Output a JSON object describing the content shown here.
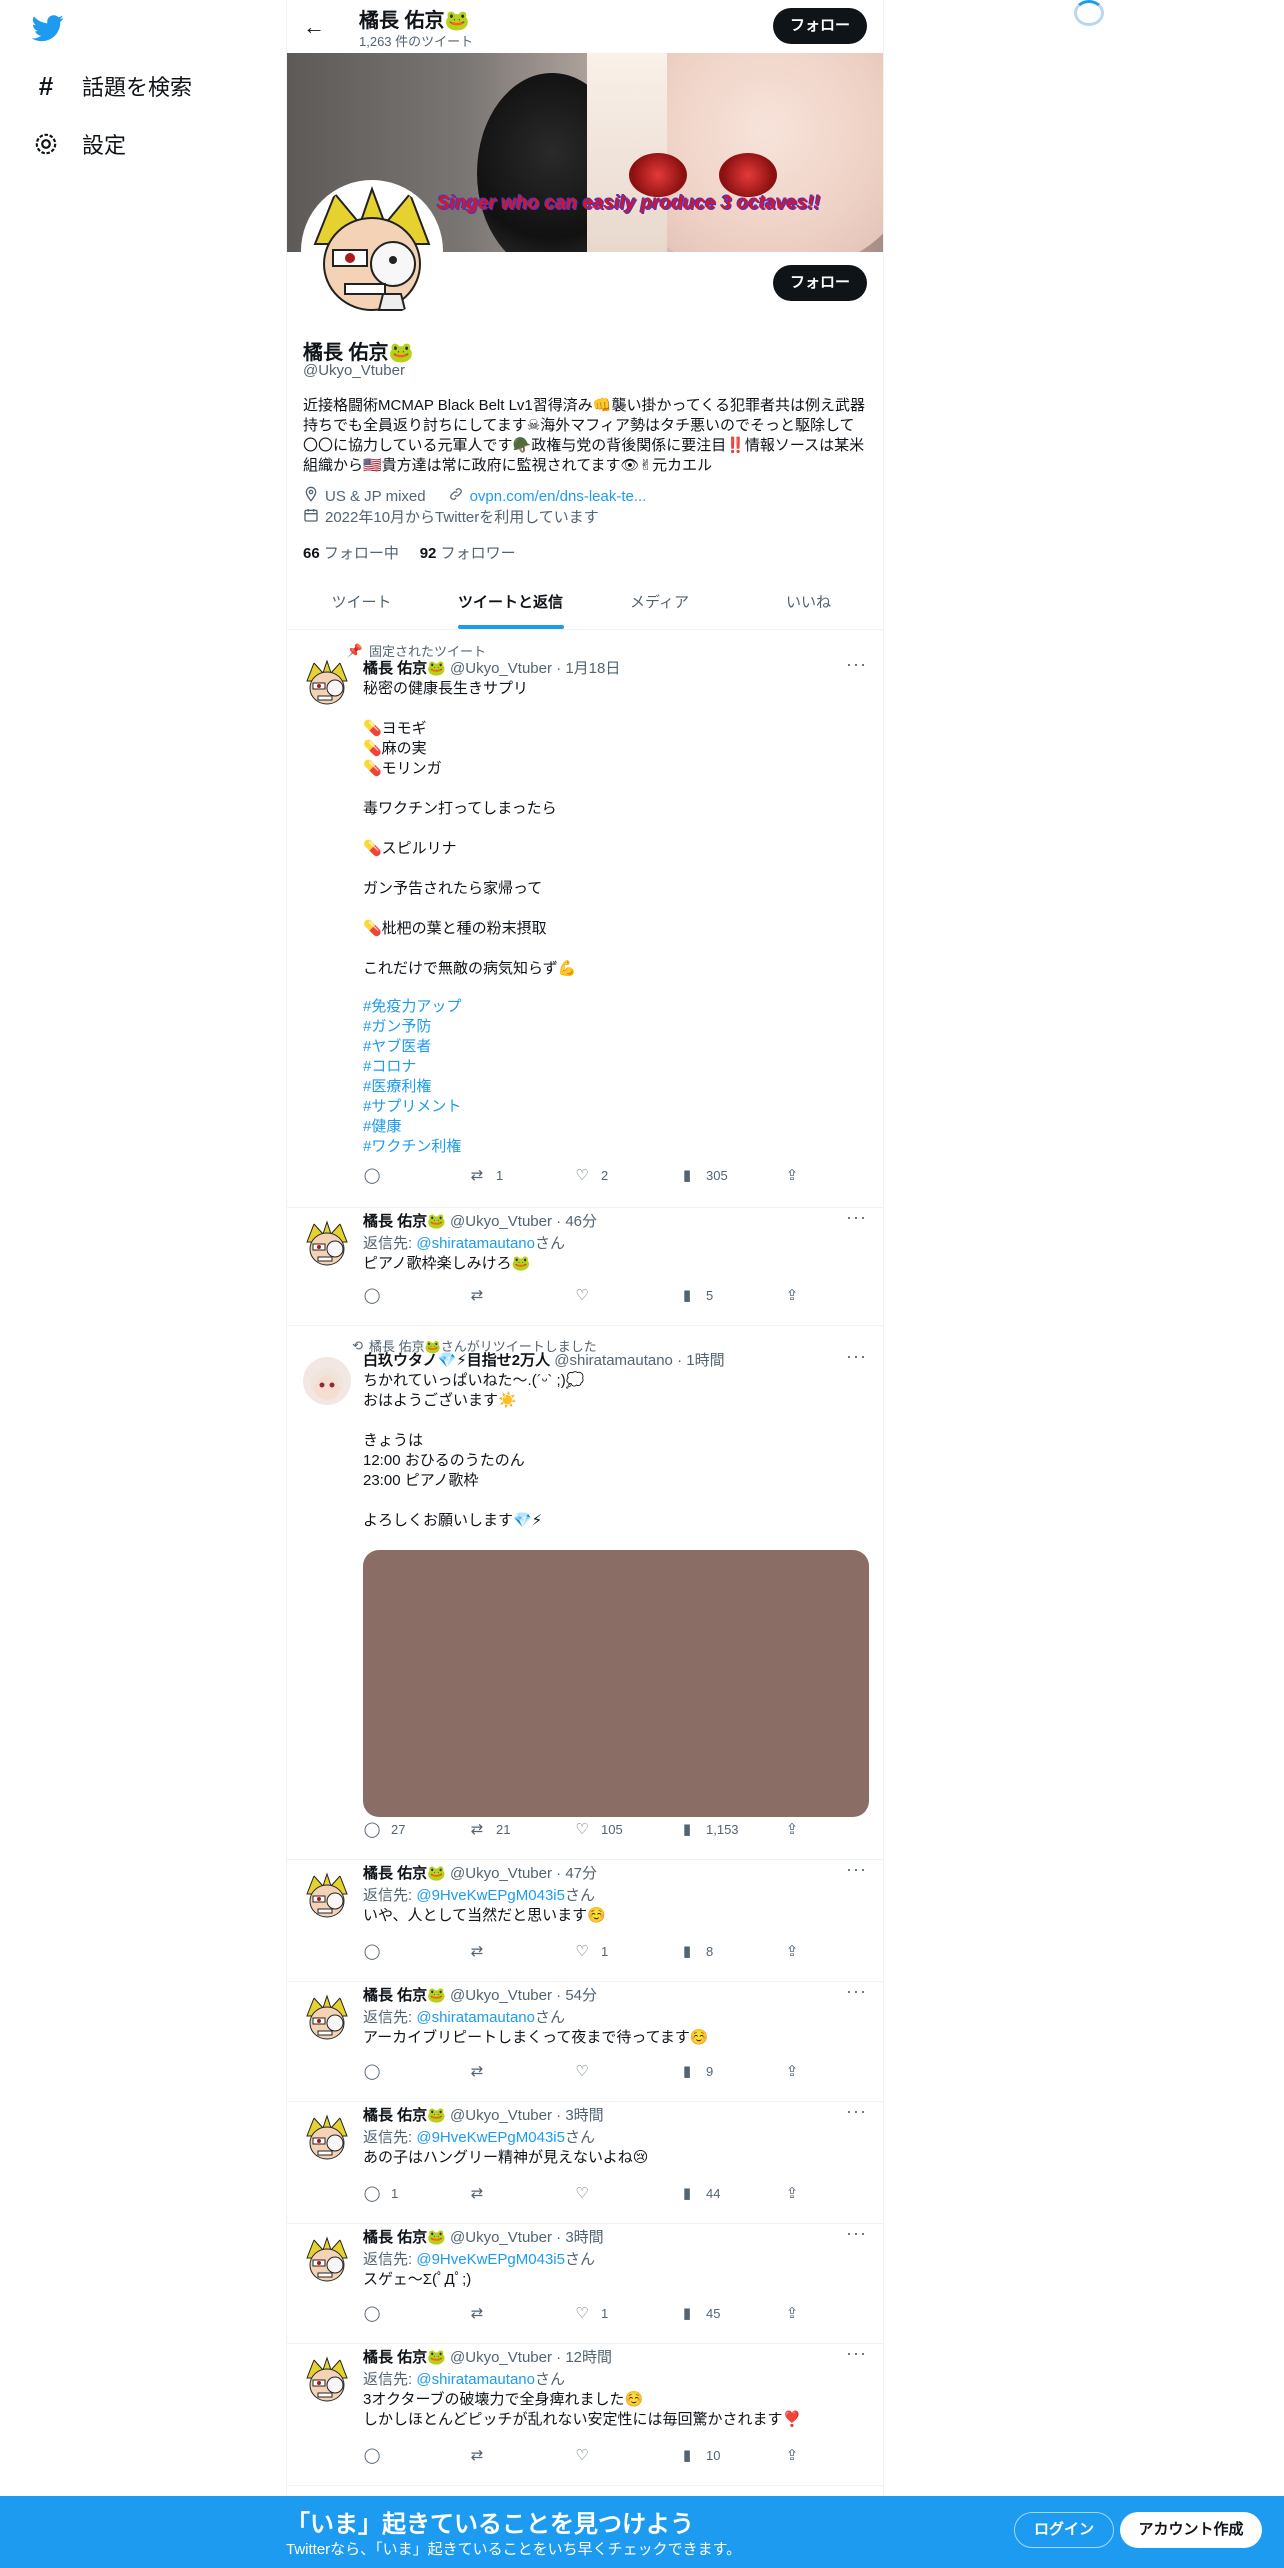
{
  "nav": {
    "explore": "話題を検索",
    "settings": "設定"
  },
  "header": {
    "name": "橘長 佑京🐸",
    "tweet_count": "1,263 件のツイート",
    "follow": "フォロー"
  },
  "banner": {
    "text": "Singer who can easily produce 3 octaves!!"
  },
  "profile": {
    "name": "橘長 佑京🐸",
    "handle": "@Ukyo_Vtuber",
    "bio": "近接格闘術MCMAP Black Belt Lv1習得済み👊襲い掛かってくる犯罪者共は例え武器持ちでも全員返り討ちにしてます☠海外マフィア勢はタチ悪いのでそっと駆除して〇〇に協力している元軍人です🪖政権与党の背後関係に要注目‼️情報ソースは某米組織から🇺🇸貴方達は常に政府に監視されてます👁✌元カエル",
    "location": "US & JP mixed",
    "url": "ovpn.com/en/dns-leak-te...",
    "joined": "2022年10月からTwitterを利用しています",
    "following_count": "66",
    "following_label": "フォロー中",
    "followers_count": "92",
    "followers_label": "フォロワー",
    "follow": "フォロー"
  },
  "tabs": [
    "ツイート",
    "ツイートと返信",
    "メディア",
    "いいね"
  ],
  "tweets": [
    {
      "social": "固定されたツイート",
      "name": "橘長 佑京🐸",
      "handle": "@Ukyo_Vtuber",
      "time": "1月18日",
      "body": "秘密の健康長生きサプリ\n\n💊ヨモギ\n💊麻の実\n💊モリンガ\n\n毒ワクチン打ってしまったら\n\n💊スピルリナ\n\nガン予告されたら家帰って\n\n💊枇杷の葉と種の粉末摂取\n\nこれだけで無敵の病気知らず💪",
      "tags": [
        "#免疫力アップ",
        "#ガン予防",
        "#ヤブ医者",
        "#コロナ",
        "#医療利権",
        "#サプリメント",
        "#健康",
        "#ワクチン利権"
      ],
      "replies": "",
      "retweets": "1",
      "likes": "2",
      "views": "305"
    },
    {
      "name": "橘長 佑京🐸",
      "handle": "@Ukyo_Vtuber",
      "time": "46分",
      "reply_label": "返信先: ",
      "reply_to": "@shiratamautano",
      "reply_suffix": "さん",
      "body": "ピアノ歌枠楽しみけろ🐸",
      "replies": "",
      "retweets": "",
      "likes": "",
      "views": "5"
    },
    {
      "social": "橘長 佑京🐸さんがリツイートしました",
      "name": "白玖ウタノ💎⚡目指せ2万人",
      "handle": "@shiratamautano",
      "time": "1時間",
      "body": "ちかれていっぱいねた〜.(´ᵕ` ;)💭\nおはようございます☀️\n\nきょうは\n12:00 おひるのうたのん\n23:00 ピアノ歌枠\n\nよろしくお願いします💎⚡",
      "replies": "27",
      "retweets": "21",
      "likes": "105",
      "views": "1,153"
    },
    {
      "name": "橘長 佑京🐸",
      "handle": "@Ukyo_Vtuber",
      "time": "47分",
      "reply_label": "返信先: ",
      "reply_to": "@9HveKwEPgM043i5",
      "reply_suffix": "さん",
      "body": "いや、人として当然だと思います☺️",
      "replies": "",
      "retweets": "",
      "likes": "1",
      "views": "8"
    },
    {
      "name": "橘長 佑京🐸",
      "handle": "@Ukyo_Vtuber",
      "time": "54分",
      "reply_label": "返信先: ",
      "reply_to": "@shiratamautano",
      "reply_suffix": "さん",
      "body": "アーカイブリピートしまくって夜まで待ってます☺️",
      "replies": "",
      "retweets": "",
      "likes": "",
      "views": "9"
    },
    {
      "name": "橘長 佑京🐸",
      "handle": "@Ukyo_Vtuber",
      "time": "3時間",
      "reply_label": "返信先: ",
      "reply_to": "@9HveKwEPgM043i5",
      "reply_suffix": "さん",
      "body": "あの子はハングリー精神が見えないよね😢",
      "replies": "1",
      "retweets": "",
      "likes": "",
      "views": "44"
    },
    {
      "name": "橘長 佑京🐸",
      "handle": "@Ukyo_Vtuber",
      "time": "3時間",
      "reply_label": "返信先: ",
      "reply_to": "@9HveKwEPgM043i5",
      "reply_suffix": "さん",
      "body": "スゲェ〜Σ(ﾟДﾟ;)",
      "replies": "",
      "retweets": "",
      "likes": "1",
      "views": "45"
    },
    {
      "name": "橘長 佑京🐸",
      "handle": "@Ukyo_Vtuber",
      "time": "12時間",
      "reply_label": "返信先: ",
      "reply_to": "@shiratamautano",
      "reply_suffix": "さん",
      "body": "3オクターブの破壊力で全身痺れました☺️\nしかしほとんどピッチが乱れない安定性には毎回驚かされます❣️",
      "replies": "",
      "retweets": "",
      "likes": "",
      "views": "10"
    }
  ],
  "bottom": {
    "title": "「いま」起きていることを見つけよう",
    "subtitle": "Twitterなら、「いま」起きていることをいち早くチェックできます。",
    "login": "ログイン",
    "signup": "アカウント作成"
  },
  "colors": {
    "accent": "#1d9bf0",
    "text": "#0f1419",
    "muted": "#536471",
    "button_dark": "#0f1419",
    "media_placeholder": "#8a6d64"
  },
  "icons": [
    "twitter-bird-icon",
    "hashtag-icon",
    "gear-icon",
    "back-arrow-icon",
    "location-icon",
    "link-icon",
    "calendar-icon",
    "pin-icon",
    "retweet-icon",
    "reply-icon",
    "like-icon",
    "views-icon",
    "share-icon",
    "more-icon"
  ]
}
